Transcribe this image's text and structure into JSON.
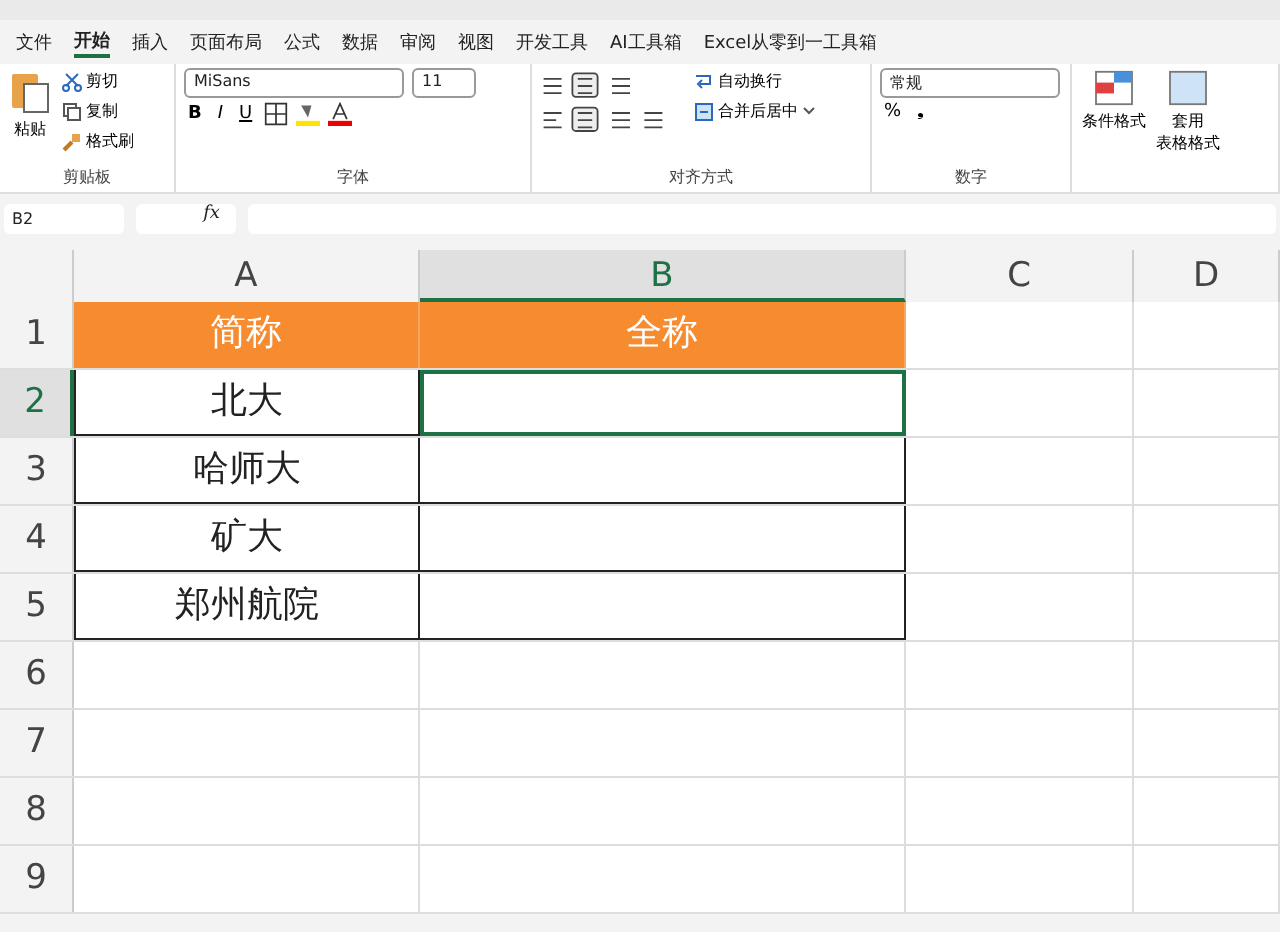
{
  "ribbon_tabs": [
    {
      "label": "文件",
      "selected": false
    },
    {
      "label": "开始",
      "selected": true
    },
    {
      "label": "插入",
      "selected": false
    },
    {
      "label": "页面布局",
      "selected": false
    },
    {
      "label": "公式",
      "selected": false
    },
    {
      "label": "数据",
      "selected": false
    },
    {
      "label": "审阅",
      "selected": false
    },
    {
      "label": "视图",
      "selected": false
    },
    {
      "label": "开发工具",
      "selected": false
    },
    {
      "label": "AI工具箱",
      "selected": false
    },
    {
      "label": "Excel从零到一工具箱",
      "selected": false
    }
  ],
  "clipboard": {
    "paste": "粘贴",
    "cut": "剪切",
    "copy": "复制",
    "format_painter": "格式刷",
    "label": "剪贴板"
  },
  "font": {
    "family": "MiSans",
    "size": "11",
    "bold": "B",
    "italic": "I",
    "underline": "U",
    "label": "字体"
  },
  "alignment": {
    "wrap": "自动换行",
    "merge": "合并后居中",
    "label": "对齐方式"
  },
  "number": {
    "format": "常规",
    "percent": "%",
    "comma": "❟",
    "label": "数字"
  },
  "styles": {
    "conditional": "条件格式",
    "table_line1": "套用",
    "table_line2": "表格格式"
  },
  "formula_bar": {
    "name_box": "B2",
    "fx": "fx"
  },
  "columns": [
    {
      "label": "A",
      "selected": false
    },
    {
      "label": "B",
      "selected": true
    },
    {
      "label": "C",
      "selected": false
    },
    {
      "label": "D",
      "selected": false
    }
  ],
  "rows": [
    {
      "label": "1",
      "selected": false,
      "kind": "header",
      "cells": [
        {
          "text": "简称",
          "selected": false
        },
        {
          "text": "全称",
          "selected": false
        }
      ]
    },
    {
      "label": "2",
      "selected": true,
      "kind": "data",
      "cells": [
        {
          "text": "北大",
          "selected": false
        },
        {
          "selected": true
        }
      ]
    },
    {
      "label": "3",
      "selected": false,
      "kind": "data",
      "cells": [
        {
          "text": "哈师大",
          "selected": false
        },
        {
          "selected": false
        }
      ]
    },
    {
      "label": "4",
      "selected": false,
      "kind": "data",
      "cells": [
        {
          "text": "矿大",
          "selected": false
        },
        {
          "selected": false
        }
      ]
    },
    {
      "label": "5",
      "selected": false,
      "kind": "data",
      "cells": [
        {
          "text": "郑州航院",
          "selected": false
        },
        {
          "selected": false
        }
      ]
    },
    {
      "label": "6",
      "selected": false
    },
    {
      "label": "7",
      "selected": false
    },
    {
      "label": "8",
      "selected": false
    },
    {
      "label": "9",
      "selected": false
    }
  ]
}
